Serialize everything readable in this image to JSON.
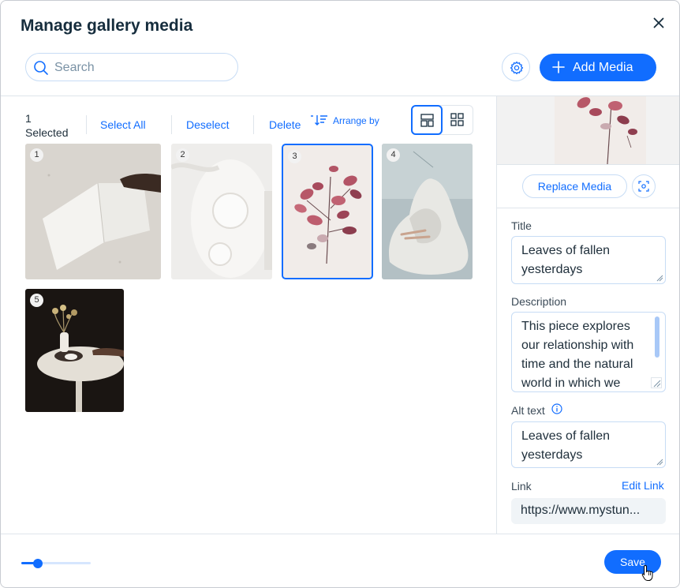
{
  "header": {
    "title": "Manage gallery media",
    "close_icon": "close-icon"
  },
  "search": {
    "placeholder": "Search",
    "value": ""
  },
  "toolbar": {
    "settings_icon": "gear-icon",
    "add_media_label": "Add Media"
  },
  "selection": {
    "count": "1",
    "label": "Selected",
    "select_all": "Select All",
    "deselect": "Deselect",
    "delete": "Delete",
    "arrange_by": "Arrange by",
    "view_modes": [
      "layout-view-icon",
      "grid-view-icon"
    ]
  },
  "gallery": {
    "items": [
      {
        "number": "1",
        "selected": false
      },
      {
        "number": "2",
        "selected": false
      },
      {
        "number": "3",
        "selected": true
      },
      {
        "number": "4",
        "selected": false
      },
      {
        "number": "5",
        "selected": false
      }
    ]
  },
  "details": {
    "replace_media": "Replace Media",
    "title_label": "Title",
    "title_value": "Leaves of fallen yesterdays",
    "description_label": "Description",
    "description_value": "This piece explores our relationship with time and the natural world in which we",
    "alt_label": "Alt text",
    "alt_value": "Leaves of fallen yesterdays",
    "link_label": "Link",
    "edit_link": "Edit Link",
    "link_value": "https://www.mystun..."
  },
  "footer": {
    "zoom_level": 0.2,
    "save_label": "Save"
  },
  "colors": {
    "accent": "#116dff",
    "border": "#c7dcf5"
  }
}
